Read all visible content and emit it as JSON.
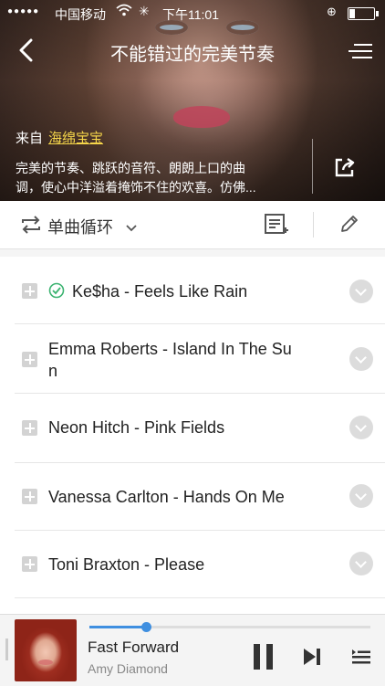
{
  "status_bar": {
    "signal_dots": "●●●●●",
    "carrier": "中国移动",
    "time": "下午11:01"
  },
  "nav": {
    "title": "不能错过的完美节奏"
  },
  "playlist": {
    "source_label": "来自",
    "creator": "海绵宝宝",
    "description_line1": "完美的节奏、跳跃的音符、朗朗上口的曲",
    "description_line2": "调，使心中洋溢着掩饰不住的欢喜。仿佛..."
  },
  "toolbar": {
    "play_mode": "单曲循环"
  },
  "songs": [
    {
      "line1": "Ke$ha - Feels Like Rain",
      "line2": "",
      "downloaded": true
    },
    {
      "line1": "Emma Roberts - Island In The Su",
      "line2": "n",
      "downloaded": false
    },
    {
      "line1": "Neon Hitch - Pink Fields",
      "line2": "",
      "downloaded": false
    },
    {
      "line1": "Vanessa Carlton - Hands On Me",
      "line2": "",
      "downloaded": false
    },
    {
      "line1": "Toni Braxton - Please",
      "line2": "",
      "downloaded": false
    }
  ],
  "player": {
    "title": "Fast Forward",
    "artist": "Amy Diamond",
    "progress": 0.2
  },
  "colors": {
    "accent": "#3f8fe0",
    "creator_link": "#f6d64a",
    "check_green": "#3cb371"
  }
}
